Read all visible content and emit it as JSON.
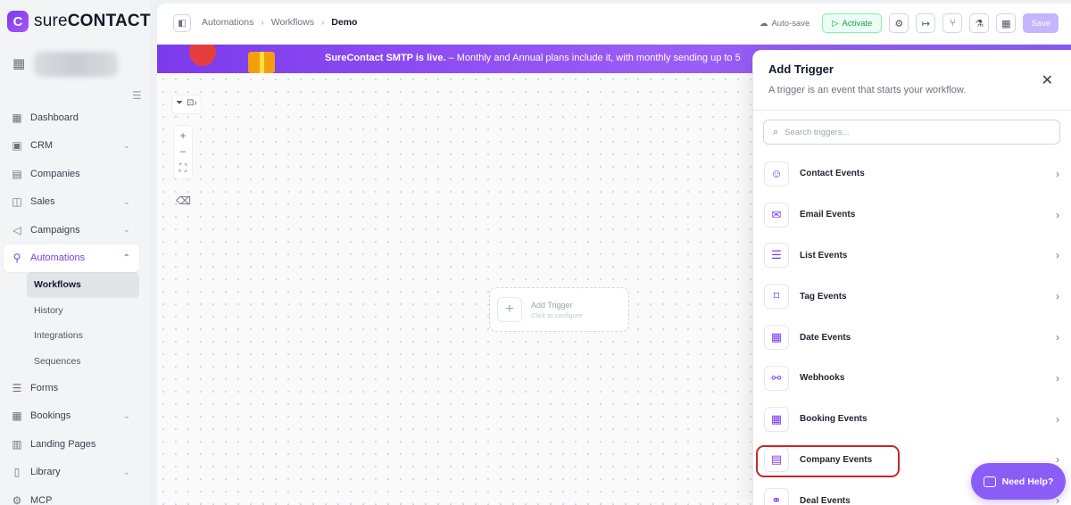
{
  "brand": {
    "logo_prefix": "sure",
    "logo_suffix": "CONTACT"
  },
  "sidebar": {
    "items": [
      {
        "label": "Dashboard",
        "icon": "grid-icon",
        "chevron": false
      },
      {
        "label": "CRM",
        "icon": "contact-card-icon",
        "chevron": true
      },
      {
        "label": "Companies",
        "icon": "building-icon",
        "chevron": false
      },
      {
        "label": "Sales",
        "icon": "briefcase-icon",
        "chevron": true
      },
      {
        "label": "Campaigns",
        "icon": "megaphone-icon",
        "chevron": true
      },
      {
        "label": "Automations",
        "icon": "flow-icon",
        "chevron": true,
        "active": true
      }
    ],
    "subitems": [
      "Workflows",
      "History",
      "Integrations",
      "Sequences"
    ],
    "items_after": [
      {
        "label": "Forms",
        "icon": "form-icon",
        "chevron": false
      },
      {
        "label": "Bookings",
        "icon": "calendar-icon",
        "chevron": true
      },
      {
        "label": "Landing Pages",
        "icon": "layout-icon",
        "chevron": false
      },
      {
        "label": "Library",
        "icon": "library-icon",
        "chevron": true
      },
      {
        "label": "MCP",
        "icon": "mcp-icon",
        "chevron": false
      }
    ]
  },
  "breadcrumb": {
    "first": "Automations",
    "second": "Workflows",
    "current": "Demo"
  },
  "toolbar": {
    "autosave": "Auto-save",
    "activate": "Activate",
    "save": "Save"
  },
  "banner": {
    "bold": "SureContact SMTP is live.",
    "text": " – Monthly and Annual plans include it, with monthly sending up to 5"
  },
  "canvas": {
    "add_trigger_title": "Add Trigger",
    "add_trigger_sub": "Click to configure"
  },
  "panel": {
    "title": "Add Trigger",
    "description": "A trigger is an event that starts your workflow.",
    "search_placeholder": "Search triggers...",
    "triggers": [
      {
        "label": "Contact Events",
        "icon": "person-icon"
      },
      {
        "label": "Email Events",
        "icon": "mail-icon"
      },
      {
        "label": "List Events",
        "icon": "list-icon"
      },
      {
        "label": "Tag Events",
        "icon": "tag-icon"
      },
      {
        "label": "Date Events",
        "icon": "calendar-icon"
      },
      {
        "label": "Webhooks",
        "icon": "webhook-icon"
      },
      {
        "label": "Booking Events",
        "icon": "calendar-icon"
      },
      {
        "label": "Company Events",
        "icon": "building-icon"
      },
      {
        "label": "Deal Events",
        "icon": "handshake-icon"
      }
    ]
  },
  "help": {
    "label": "Need Help?"
  },
  "colors": {
    "accent": "#7c3aed",
    "highlight": "#c62828",
    "activate": "#16a34a"
  }
}
